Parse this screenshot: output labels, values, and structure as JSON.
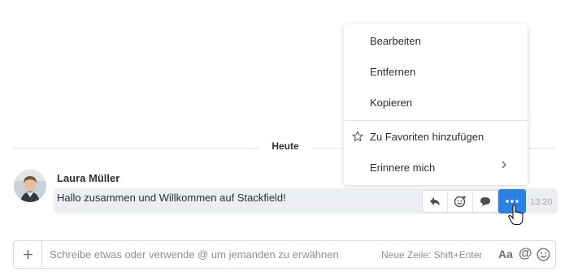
{
  "chat": {
    "day_label": "Heute",
    "message": {
      "author": "Laura Müller",
      "text": "Hallo zusammen und Willkommen auf Stackfield!",
      "time": "13:20"
    }
  },
  "message_actions": [
    "reply-icon",
    "add-reaction-icon",
    "comment-icon",
    "more-icon"
  ],
  "context_menu": {
    "items": [
      {
        "label": "Bearbeiten"
      },
      {
        "label": "Entfernen"
      },
      {
        "label": "Kopieren"
      },
      {
        "label": "Zu Favoriten hinzufügen",
        "icon": "star-icon"
      },
      {
        "label": "Erinnere mich",
        "icon": "chevron-right-icon"
      }
    ]
  },
  "composer": {
    "placeholder": "Schreibe etwas oder verwende @ um jemanden zu erwähnen",
    "hint": "Neue Zeile: Shift+Enter",
    "format_label": "Aa",
    "mention_label": "@"
  },
  "colors": {
    "accent": "#2c80e4",
    "bubble": "#eceef1"
  }
}
